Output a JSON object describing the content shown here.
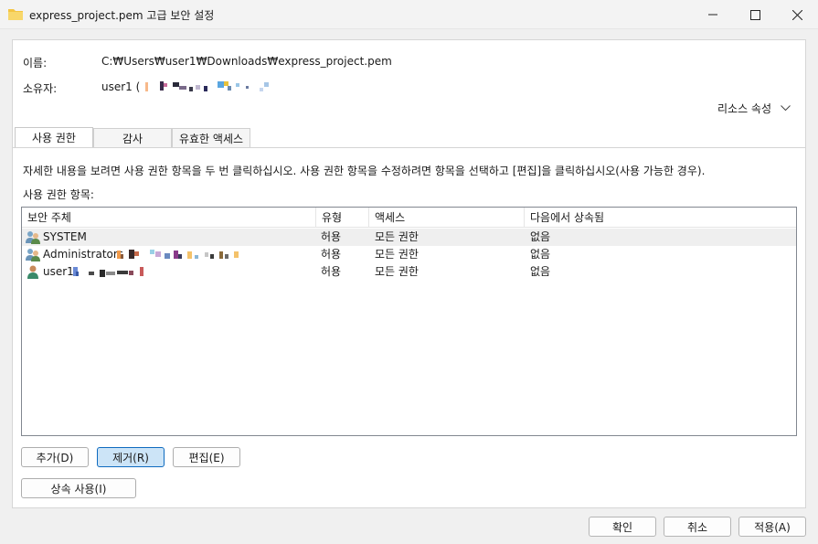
{
  "window": {
    "title": "express_project.pem 고급 보안 설정",
    "minimize": "—",
    "maximize": "☐",
    "close": "✕"
  },
  "info": {
    "name_label": "이름:",
    "name_value": "C:₩Users₩user1₩Downloads₩express_project.pem",
    "owner_label": "소유자:",
    "owner_value": "user1 (",
    "resource_properties": "리소스 속성"
  },
  "tabs": [
    "사용 권한",
    "감사",
    "유효한 액세스"
  ],
  "description": "자세한 내용을 보려면 사용 권한 항목을 두 번 클릭하십시오. 사용 권한 항목을 수정하려면 항목을 선택하고 [편집]을 클릭하십시오(사용 가능한 경우).",
  "entries_label": "사용 권한 항목:",
  "columns": [
    "보안 주체",
    "유형",
    "액세스",
    "다음에서 상속됨"
  ],
  "rows": [
    {
      "principal": "SYSTEM",
      "type": "허용",
      "access": "모든 권한",
      "inherited": "없음",
      "icon": "group-users-icon"
    },
    {
      "principal": "Administrators",
      "type": "허용",
      "access": "모든 권한",
      "inherited": "없음",
      "icon": "group-users-icon"
    },
    {
      "principal": "user1",
      "type": "허용",
      "access": "모든 권한",
      "inherited": "없음",
      "icon": "user-icon"
    }
  ],
  "buttons": {
    "add": "추가(D)",
    "remove": "제거(R)",
    "edit": "편집(E)",
    "enable_inheritance": "상속 사용(I)",
    "ok": "확인",
    "cancel": "취소",
    "apply": "적용(A)"
  },
  "colors": {
    "selected_button": "#cce4f7",
    "selected_border": "#0f6bbf",
    "folder": "#f4c542"
  }
}
